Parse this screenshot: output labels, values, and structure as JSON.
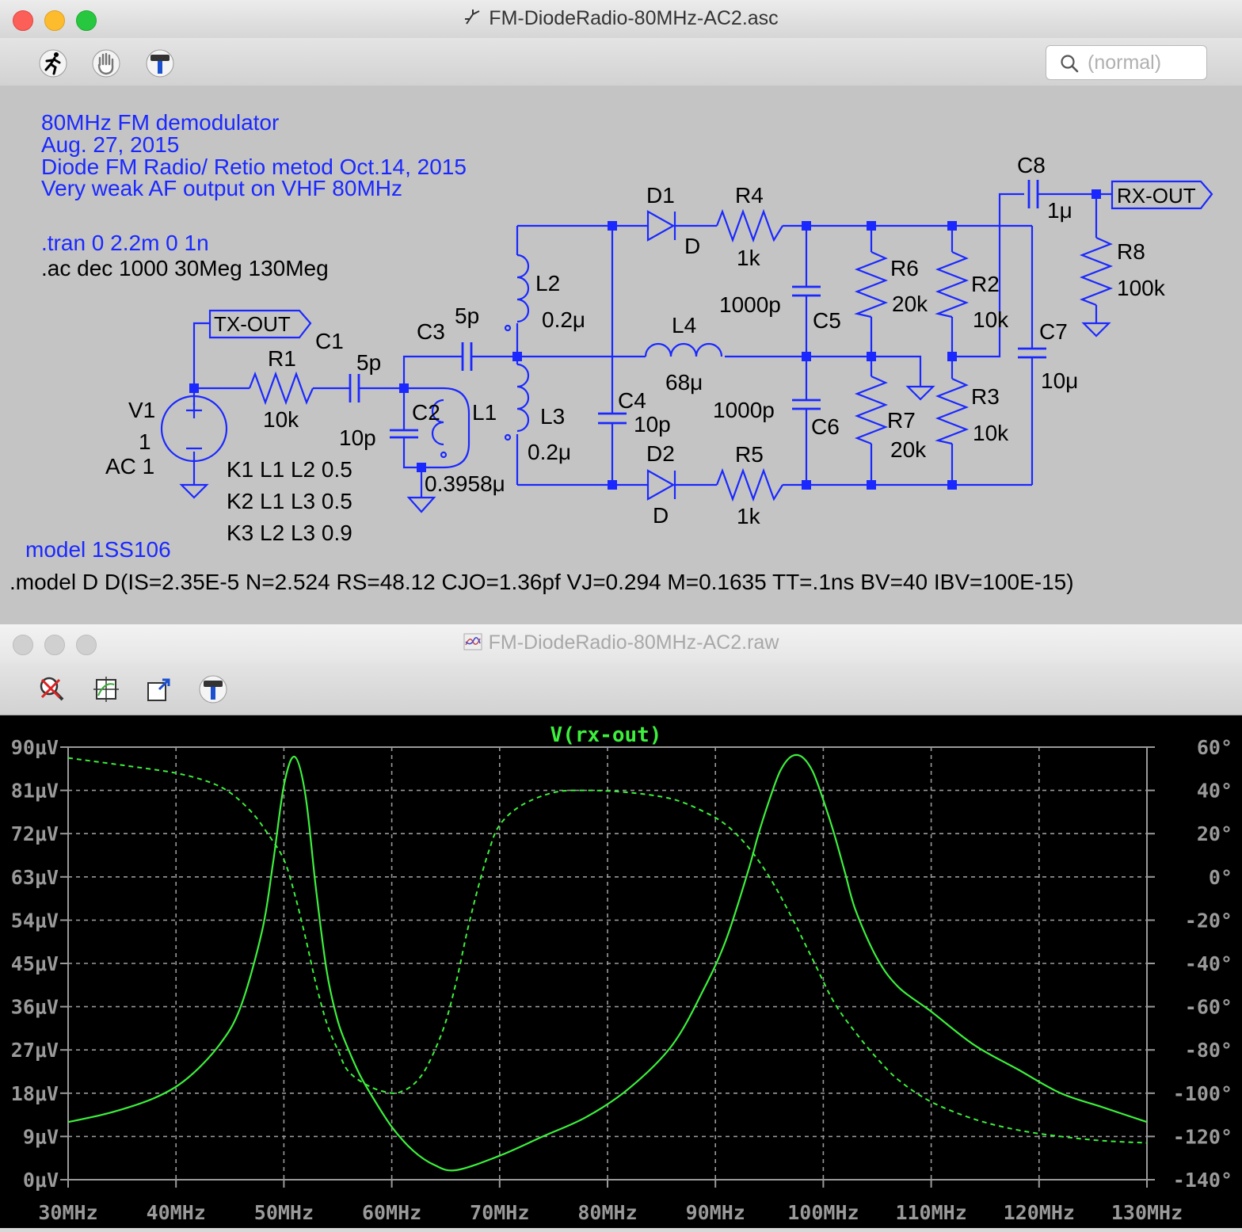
{
  "schematic_window": {
    "title": "FM-DiodeRadio-80MHz-AC2.asc",
    "title_icon": "schematic-icon",
    "toolbar": [
      {
        "name": "run-icon"
      },
      {
        "name": "hand-icon"
      },
      {
        "name": "hammer-icon"
      }
    ],
    "search": {
      "placeholder": "(normal)",
      "icon": "magnifier-icon"
    },
    "comments": [
      "80MHz FM demodulator",
      "Aug. 27, 2015",
      "Diode FM Radio/ Retio metod Oct.14, 2015",
      "Very weak AF output on VHF 80MHz"
    ],
    "directives": {
      "tran": ".tran 0 2.2m 0 1n",
      "ac": ".ac dec 1000 30Meg 130Meg",
      "k1": "K1 L1 L2 0.5",
      "k2": "K2 L1 L3 0.5",
      "k3": "K3 L2 L3 0.9",
      "model_comment": "model 1SS106",
      "model": ".model D D(IS=2.35E-5 N=2.524 RS=48.12 CJO=1.36pf VJ=0.294 M=0.1635 TT=.1ns BV=40 IBV=100E-15)"
    },
    "labels": {
      "tx_out": "TX-OUT",
      "rx_out": "RX-OUT",
      "v1": "V1",
      "v1_val": "1",
      "v1_ac": "AC 1",
      "r1": "R1",
      "r1_val": "10k",
      "c1": "C1",
      "c1_val": "5p",
      "c2": "C2",
      "c2_val": "10p",
      "c3": "C3",
      "c3_val": "5p",
      "l1": "L1",
      "l1_val": "0.3958μ",
      "l2": "L2",
      "l2_val": "0.2μ",
      "l3": "L3",
      "l3_val": "0.2μ",
      "l4": "L4",
      "l4_val": "68μ",
      "c4": "C4",
      "c4_val": "10p",
      "d1": "D1",
      "d1_val": "D",
      "d2": "D2",
      "d2_val": "D",
      "r4": "R4",
      "r4_val": "1k",
      "r5": "R5",
      "r5_val": "1k",
      "c5": "C5",
      "c5_val": "1000p",
      "c6": "C6",
      "c6_val": "1000p",
      "r6": "R6",
      "r6_val": "20k",
      "r7": "R7",
      "r7_val": "20k",
      "r2": "R2",
      "r2_val": "10k",
      "r3": "R3",
      "r3_val": "10k",
      "c7": "C7",
      "c7_val": "10μ",
      "c8": "C8",
      "c8_val": "1μ",
      "r8": "R8",
      "r8_val": "100k"
    },
    "colors": {
      "wire": "#1a28ff",
      "comment": "#1a28ff",
      "directive": "#000000",
      "node": "#1a28ff"
    }
  },
  "plot_window": {
    "title": "FM-DiodeRadio-80MHz-AC2.raw",
    "title_icon": "waveform-icon",
    "toolbar": [
      {
        "name": "zoom-cancel-icon"
      },
      {
        "name": "autorange-icon"
      },
      {
        "name": "zoom-back-icon"
      },
      {
        "name": "hammer-icon"
      }
    ]
  },
  "chart_data": {
    "type": "line",
    "title": "V(rx-out)",
    "xlim": [
      30,
      130
    ],
    "ylim": [
      0,
      90
    ],
    "y2lim": [
      -140,
      60
    ],
    "x_ticks": [
      "30MHz",
      "40MHz",
      "50MHz",
      "60MHz",
      "70MHz",
      "80MHz",
      "90MHz",
      "100MHz",
      "110MHz",
      "120MHz",
      "130MHz"
    ],
    "y_ticks": [
      "0μV",
      "9μV",
      "18μV",
      "27μV",
      "36μV",
      "45μV",
      "54μV",
      "63μV",
      "72μV",
      "81μV",
      "90μV"
    ],
    "y2_ticks": [
      "-140°",
      "-120°",
      "-100°",
      "-80°",
      "-60°",
      "-40°",
      "-20°",
      "0°",
      "20°",
      "40°",
      "60°"
    ],
    "grid": true,
    "color": "#3cf03c",
    "series": [
      {
        "name": "magnitude",
        "axis": "left",
        "style": "solid",
        "x": [
          30,
          34,
          38,
          41,
          44,
          46,
          48,
          49,
          50,
          51,
          52,
          53,
          54,
          55,
          56,
          57,
          58,
          60,
          62,
          64,
          66,
          70,
          74,
          78,
          82,
          86,
          89,
          91,
          93,
          94,
          95,
          96,
          97,
          98,
          99,
          100,
          101,
          102,
          103,
          105,
          107,
          110,
          114,
          118,
          122,
          126,
          130
        ],
        "y": [
          12,
          14,
          17,
          21,
          28,
          36,
          52,
          66,
          82,
          88,
          80,
          60,
          43,
          33,
          27,
          22,
          18,
          11,
          6,
          3,
          2,
          5,
          9,
          13,
          19,
          28,
          40,
          50,
          64,
          72,
          79,
          85,
          88,
          88,
          85,
          79,
          72,
          64,
          56,
          46,
          40,
          35,
          28,
          23,
          18,
          15,
          12
        ]
      },
      {
        "name": "phase",
        "axis": "right",
        "style": "dashed",
        "x": [
          30,
          36,
          40,
          43,
          45,
          47,
          48.5,
          50,
          51,
          52,
          53,
          54,
          55,
          56,
          58,
          60,
          61,
          62,
          63,
          64,
          65,
          66,
          67,
          68,
          69,
          70,
          72,
          75,
          78,
          82,
          86,
          89,
          91,
          93,
          95,
          97,
          99,
          101,
          103,
          105,
          107,
          110,
          114,
          118,
          122,
          126,
          130
        ],
        "y": [
          55,
          51,
          48,
          44,
          39,
          30,
          20,
          8,
          -8,
          -28,
          -50,
          -68,
          -80,
          -90,
          -97,
          -100,
          -99,
          -96,
          -90,
          -80,
          -67,
          -48,
          -25,
          -5,
          12,
          24,
          33,
          39,
          40,
          39,
          36,
          30,
          24,
          14,
          0,
          -18,
          -38,
          -58,
          -72,
          -84,
          -94,
          -104,
          -112,
          -117,
          -120,
          -122,
          -123
        ]
      }
    ]
  }
}
